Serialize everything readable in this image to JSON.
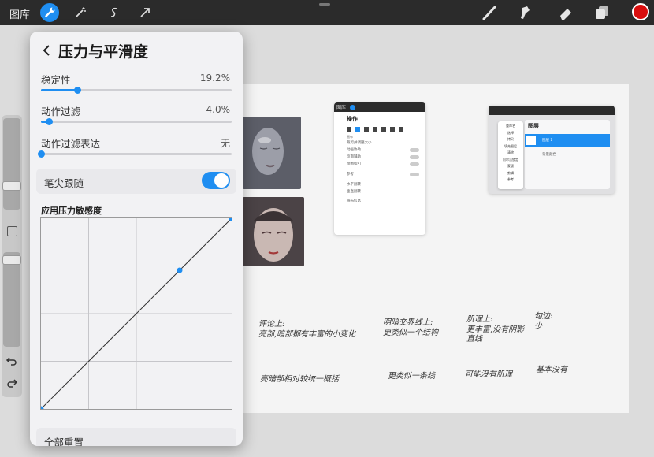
{
  "toolbar": {
    "gallery_label": "图库",
    "left_tools": [
      "wrench-icon",
      "magic-wand-icon",
      "selection-icon",
      "transform-arrow-icon"
    ],
    "right_tools": [
      "brush-icon",
      "smudge-icon",
      "eraser-icon",
      "layers-icon"
    ],
    "current_color": "#d90d0d",
    "accent": "#1f8ef1"
  },
  "panel": {
    "title": "压力与平滑度",
    "rows": [
      {
        "label": "稳定性",
        "value": "19.2%",
        "level": 0.192
      },
      {
        "label": "动作过滤",
        "value": "4.0%",
        "level": 0.04
      },
      {
        "label": "动作过滤表达",
        "value": "无",
        "level": 0.0
      }
    ],
    "toggle": {
      "label": "笔尖跟随",
      "on": true
    },
    "curve_title": "应用压力敏感度",
    "reset_label": "全部重置"
  },
  "canvas": {
    "notes_row1": [
      "评论上:\n亮部,暗部都有丰富的小变化",
      "明暗交界线上:\n更类似一个结构",
      "肌理上:\n更丰富,没有阴影\n直线",
      "勾边:\n少"
    ],
    "notes_row2": [
      "亮暗部相对较统一概括",
      "更类似一条线",
      "可能没有肌理",
      "基本没有"
    ],
    "mini_actions": {
      "gallery": "图库",
      "title": "操作",
      "items": [
        "画布",
        "裁剪并调整大小",
        "动画协助",
        "页面辅助",
        "绘图指引",
        "参考",
        "水平翻转",
        "垂直翻转",
        "画布信息"
      ]
    },
    "mini_layers": {
      "title": "图层",
      "layer1": "图层 1",
      "background": "背景颜色",
      "menu": [
        "重命名",
        "选择",
        "拷贝",
        "填充图层",
        "清除",
        "阿尔法锁定",
        "蒙版",
        "剪辑",
        "参考"
      ]
    }
  }
}
